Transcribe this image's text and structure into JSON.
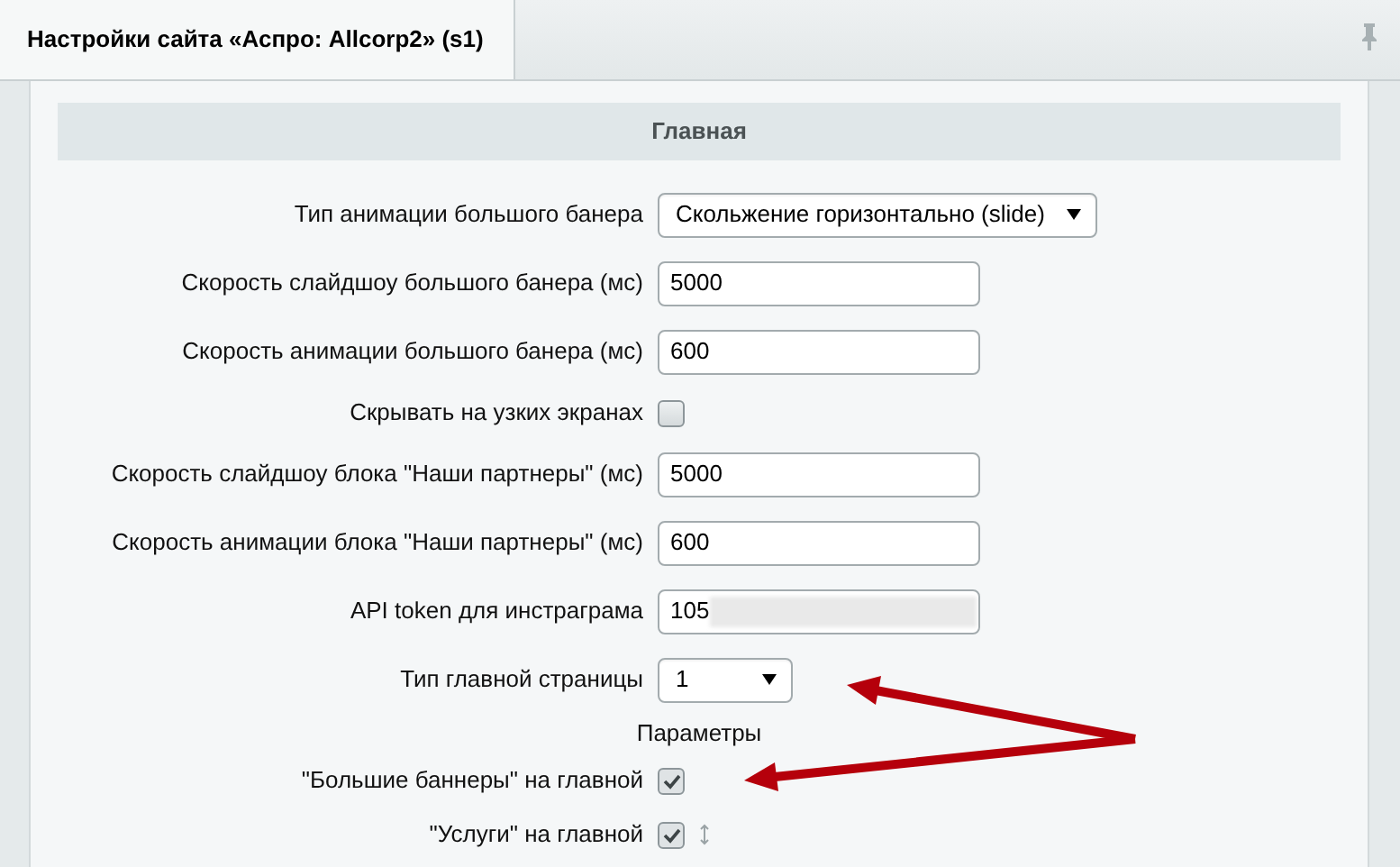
{
  "tab": {
    "title": "Настройки сайта «Аспро: Allcorp2» (s1)",
    "selected": true
  },
  "section": {
    "title": "Главная"
  },
  "rows": [
    {
      "kind": "select",
      "label": "Тип анимации большого банера",
      "value": "Скольжение горизонтально (slide)"
    },
    {
      "kind": "input",
      "label": "Скорость слайдшоу большого банера (мс)",
      "value": "5000"
    },
    {
      "kind": "input",
      "label": "Скорость анимации большого банера (мс)",
      "value": "600"
    },
    {
      "kind": "checkbox",
      "label": "Скрывать на узких экранах",
      "checked": false
    },
    {
      "kind": "input",
      "label": "Скорость слайдшоу блока \"Наши партнеры\" (мс)",
      "value": "5000"
    },
    {
      "kind": "input",
      "label": "Скорость анимации блока \"Наши партнеры\" (мс)",
      "value": "600"
    },
    {
      "kind": "input",
      "label": "API token для инстраграма",
      "value": "105",
      "masked": true
    },
    {
      "kind": "select",
      "label": "Тип главной страницы",
      "value": "1"
    },
    {
      "kind": "heading",
      "label": "Параметры"
    },
    {
      "kind": "checkbox",
      "label": "\"Большие баннеры\" на главной",
      "checked": true
    },
    {
      "kind": "checkbox",
      "label": "\"Услуги\" на главной",
      "checked": true,
      "draggable": true
    }
  ]
}
